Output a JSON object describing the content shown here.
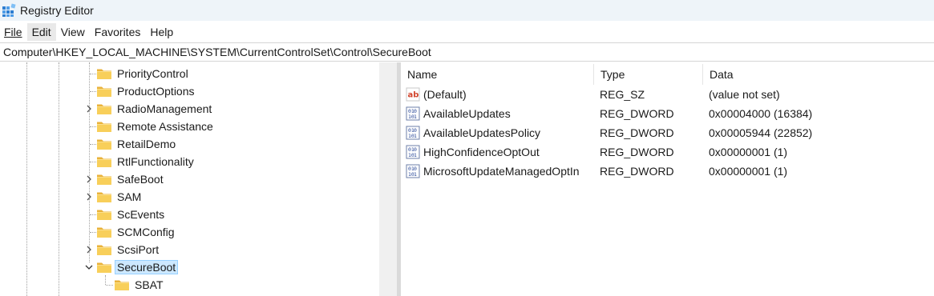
{
  "window": {
    "title": "Registry Editor"
  },
  "menu": [
    {
      "label": "File"
    },
    {
      "label": "Edit"
    },
    {
      "label": "View"
    },
    {
      "label": "Favorites"
    },
    {
      "label": "Help"
    }
  ],
  "address": "Computer\\HKEY_LOCAL_MACHINE\\SYSTEM\\CurrentControlSet\\Control\\SecureBoot",
  "tree": {
    "items": [
      {
        "label": "PriorityControl",
        "expandable": false
      },
      {
        "label": "ProductOptions",
        "expandable": false
      },
      {
        "label": "RadioManagement",
        "expandable": true
      },
      {
        "label": "Remote Assistance",
        "expandable": false
      },
      {
        "label": "RetailDemo",
        "expandable": false
      },
      {
        "label": "RtlFunctionality",
        "expandable": false
      },
      {
        "label": "SafeBoot",
        "expandable": true
      },
      {
        "label": "SAM",
        "expandable": true
      },
      {
        "label": "ScEvents",
        "expandable": false
      },
      {
        "label": "SCMConfig",
        "expandable": false
      },
      {
        "label": "ScsiPort",
        "expandable": true
      },
      {
        "label": "SecureBoot",
        "expandable": true,
        "expanded": true,
        "selected": true
      },
      {
        "label": "SBAT",
        "expandable": false,
        "child": true
      }
    ]
  },
  "values": {
    "columns": {
      "name": "Name",
      "type": "Type",
      "data": "Data"
    },
    "rows": [
      {
        "name": "(Default)",
        "type": "REG_SZ",
        "data": "(value not set)",
        "icon": "string-value-icon"
      },
      {
        "name": "AvailableUpdates",
        "type": "REG_DWORD",
        "data": "0x00004000 (16384)",
        "icon": "binary-value-icon"
      },
      {
        "name": "AvailableUpdatesPolicy",
        "type": "REG_DWORD",
        "data": "0x00005944 (22852)",
        "icon": "binary-value-icon"
      },
      {
        "name": "HighConfidenceOptOut",
        "type": "REG_DWORD",
        "data": "0x00000001 (1)",
        "icon": "binary-value-icon"
      },
      {
        "name": "MicrosoftUpdateManagedOptIn",
        "type": "REG_DWORD",
        "data": "0x00000001 (1)",
        "icon": "binary-value-icon"
      }
    ]
  },
  "colors": {
    "folder": "#f5c542",
    "selection": "#cce8ff",
    "titlebar": "#eef4f9"
  }
}
